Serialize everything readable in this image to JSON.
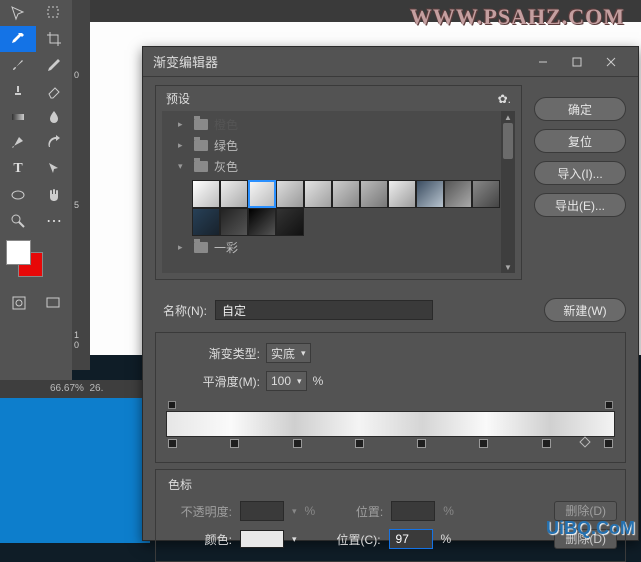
{
  "watermarks": {
    "top": "WWW.PSAHZ.COM",
    "bottom": "UiBQ.CoM"
  },
  "zoom": {
    "label": "66.67%",
    "extra": "26."
  },
  "toolbar": {
    "fg_color": "#ffffff",
    "bg_color": "#e70808"
  },
  "dialog": {
    "title": "渐变编辑器",
    "presets": {
      "title": "预设",
      "folders": [
        {
          "name": "橙色",
          "expanded": false,
          "shown_as_dark": true
        },
        {
          "name": "绿色",
          "expanded": false
        },
        {
          "name": "灰色",
          "expanded": true
        },
        {
          "name": "一彩",
          "expanded": false
        }
      ]
    },
    "buttons": {
      "ok": "确定",
      "reset": "复位",
      "import": "导入(I)...",
      "export": "导出(E)...",
      "new": "新建(W)"
    },
    "name": {
      "label": "名称(N):",
      "value": "自定"
    },
    "gradtype": {
      "label": "渐变类型:",
      "value": "实底"
    },
    "smoothness": {
      "label": "平滑度(M):",
      "value": "100",
      "unit": "%"
    },
    "stops": {
      "header": "色标",
      "opacity_label": "不透明度:",
      "opacity_unit": "%",
      "pos_label1": "位置:",
      "pos_unit1": "%",
      "delete1": "删除(D)",
      "color_label": "颜色:",
      "pos_label2": "位置(C):",
      "pos_value": "97",
      "pos_unit2": "%",
      "delete2": "删除(D)"
    }
  }
}
